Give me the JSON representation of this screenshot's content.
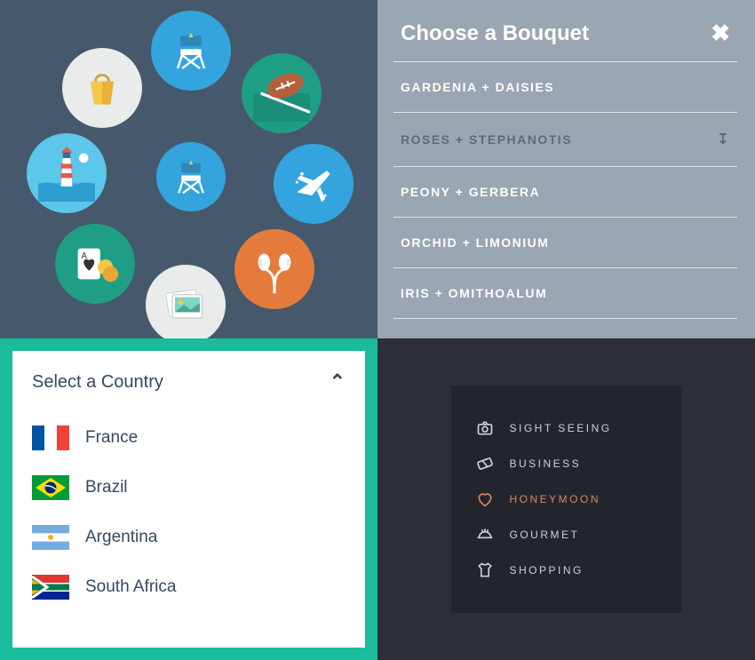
{
  "circleIcons": [
    "chair",
    "football",
    "airplane",
    "earbuds",
    "photos",
    "cards",
    "lighthouse",
    "shopping-bag",
    "chair-center"
  ],
  "bouquet": {
    "title": "Choose a Bouquet",
    "items": [
      {
        "label": "GARDENIA + DAISIES",
        "selected": false
      },
      {
        "label": "ROSES + STEPHANOTIS",
        "selected": true
      },
      {
        "label": "PEONY + GERBERA",
        "selected": false
      },
      {
        "label": "ORCHID + LIMONIUM",
        "selected": false
      },
      {
        "label": "IRIS + OMITHOALUM",
        "selected": false
      }
    ]
  },
  "country": {
    "title": "Select a Country",
    "items": [
      {
        "label": "France",
        "flag": "france"
      },
      {
        "label": "Brazil",
        "flag": "brazil"
      },
      {
        "label": "Argentina",
        "flag": "argentina"
      },
      {
        "label": "South Africa",
        "flag": "south-africa"
      }
    ]
  },
  "activities": {
    "items": [
      {
        "label": "SIGHT SEEING",
        "icon": "camera",
        "highlight": false
      },
      {
        "label": "BUSINESS",
        "icon": "ticket",
        "highlight": false
      },
      {
        "label": "HONEYMOON",
        "icon": "heart",
        "highlight": true
      },
      {
        "label": "GOURMET",
        "icon": "dish",
        "highlight": false
      },
      {
        "label": "SHOPPING",
        "icon": "tshirt",
        "highlight": false
      }
    ]
  }
}
